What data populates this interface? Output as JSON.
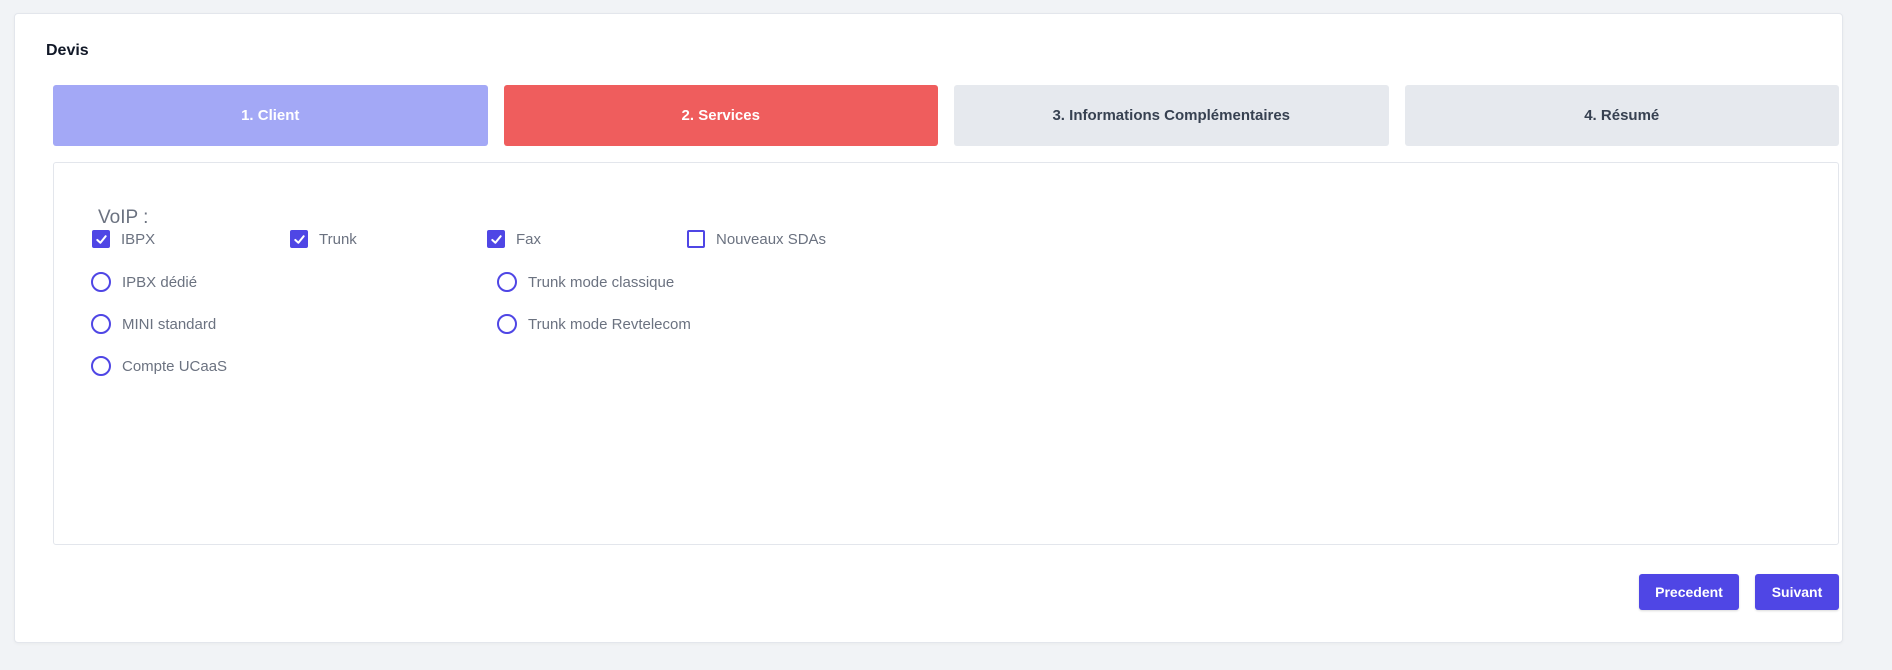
{
  "card": {
    "title": "Devis"
  },
  "steps": [
    {
      "label": "1. Client",
      "state": "done"
    },
    {
      "label": "2. Services",
      "state": "active"
    },
    {
      "label": "3. Informations Complémentaires",
      "state": "todo"
    },
    {
      "label": "4. Résumé",
      "state": "todo"
    }
  ],
  "voip": {
    "label": "VoIP :",
    "checkboxes": [
      {
        "label": "IBPX",
        "checked": true
      },
      {
        "label": "Trunk",
        "checked": true
      },
      {
        "label": "Fax",
        "checked": true
      },
      {
        "label": "Nouveaux SDAs",
        "checked": false
      }
    ],
    "ibpx_radios": [
      {
        "label": "IPBX dédié",
        "selected": false
      },
      {
        "label": "MINI standard",
        "selected": false
      },
      {
        "label": "Compte UCaaS",
        "selected": false
      }
    ],
    "trunk_radios": [
      {
        "label": "Trunk mode classique",
        "selected": false
      },
      {
        "label": "Trunk mode Revtelecom",
        "selected": false
      }
    ]
  },
  "buttons": {
    "previous": "Precedent",
    "next": "Suivant"
  },
  "colors": {
    "accent": "#4f46e5",
    "step_done": "#a3a8f6",
    "step_active": "#ef5d5d",
    "step_todo": "#e6e9ee"
  }
}
